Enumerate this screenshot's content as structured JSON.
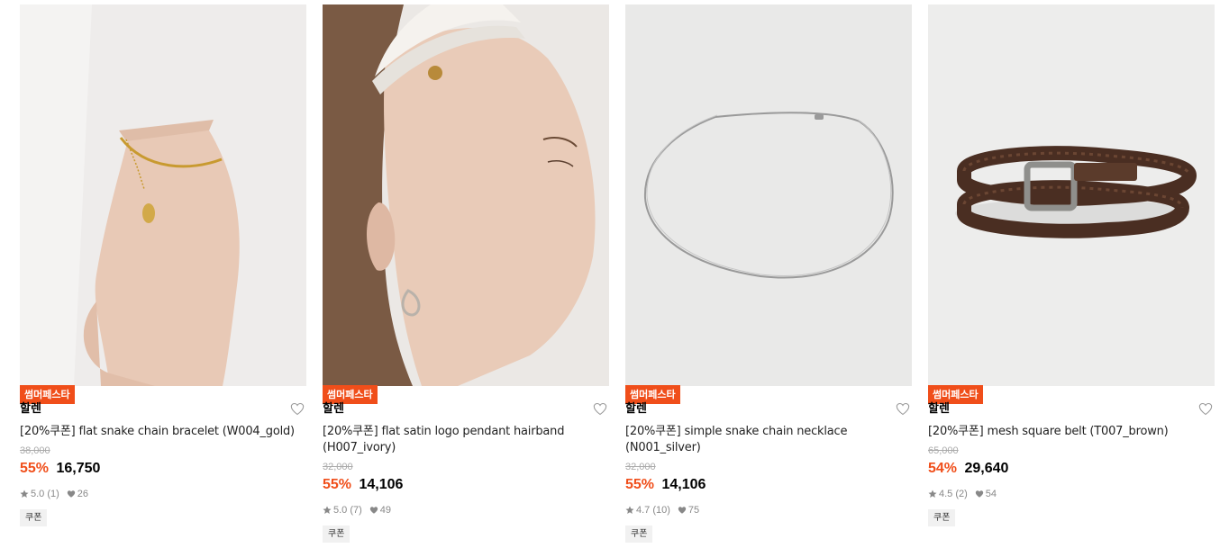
{
  "products": [
    {
      "badge": "썸머페스타",
      "brand": "할렌",
      "name": "[20%쿠폰] flat snake chain bracelet (W004_gold)",
      "original_price": "38,000",
      "discount": "55%",
      "price": "16,750",
      "rating": "5.0 (1)",
      "likes": "26",
      "coupon": "쿠폰"
    },
    {
      "badge": "썸머페스타",
      "brand": "할렌",
      "name": "[20%쿠폰] flat satin logo pendant hairband (H007_ivory)",
      "original_price": "32,000",
      "discount": "55%",
      "price": "14,106",
      "rating": "5.0 (7)",
      "likes": "49",
      "coupon": "쿠폰"
    },
    {
      "badge": "썸머페스타",
      "brand": "할렌",
      "name": "[20%쿠폰] simple snake chain necklace (N001_silver)",
      "original_price": "32,000",
      "discount": "55%",
      "price": "14,106",
      "rating": "4.7 (10)",
      "likes": "75",
      "coupon": "쿠폰"
    },
    {
      "badge": "썸머페스타",
      "brand": "할렌",
      "name": "[20%쿠폰] mesh square belt (T007_brown)",
      "original_price": "65,000",
      "discount": "54%",
      "price": "29,640",
      "rating": "4.5 (2)",
      "likes": "54",
      "coupon": "쿠폰"
    }
  ],
  "colors": {
    "accent": "#f04e1a",
    "muted": "#888888"
  },
  "icons": {
    "wishlist": "heart-outline-icon",
    "rating": "star-icon",
    "likes": "heart-filled-icon"
  }
}
